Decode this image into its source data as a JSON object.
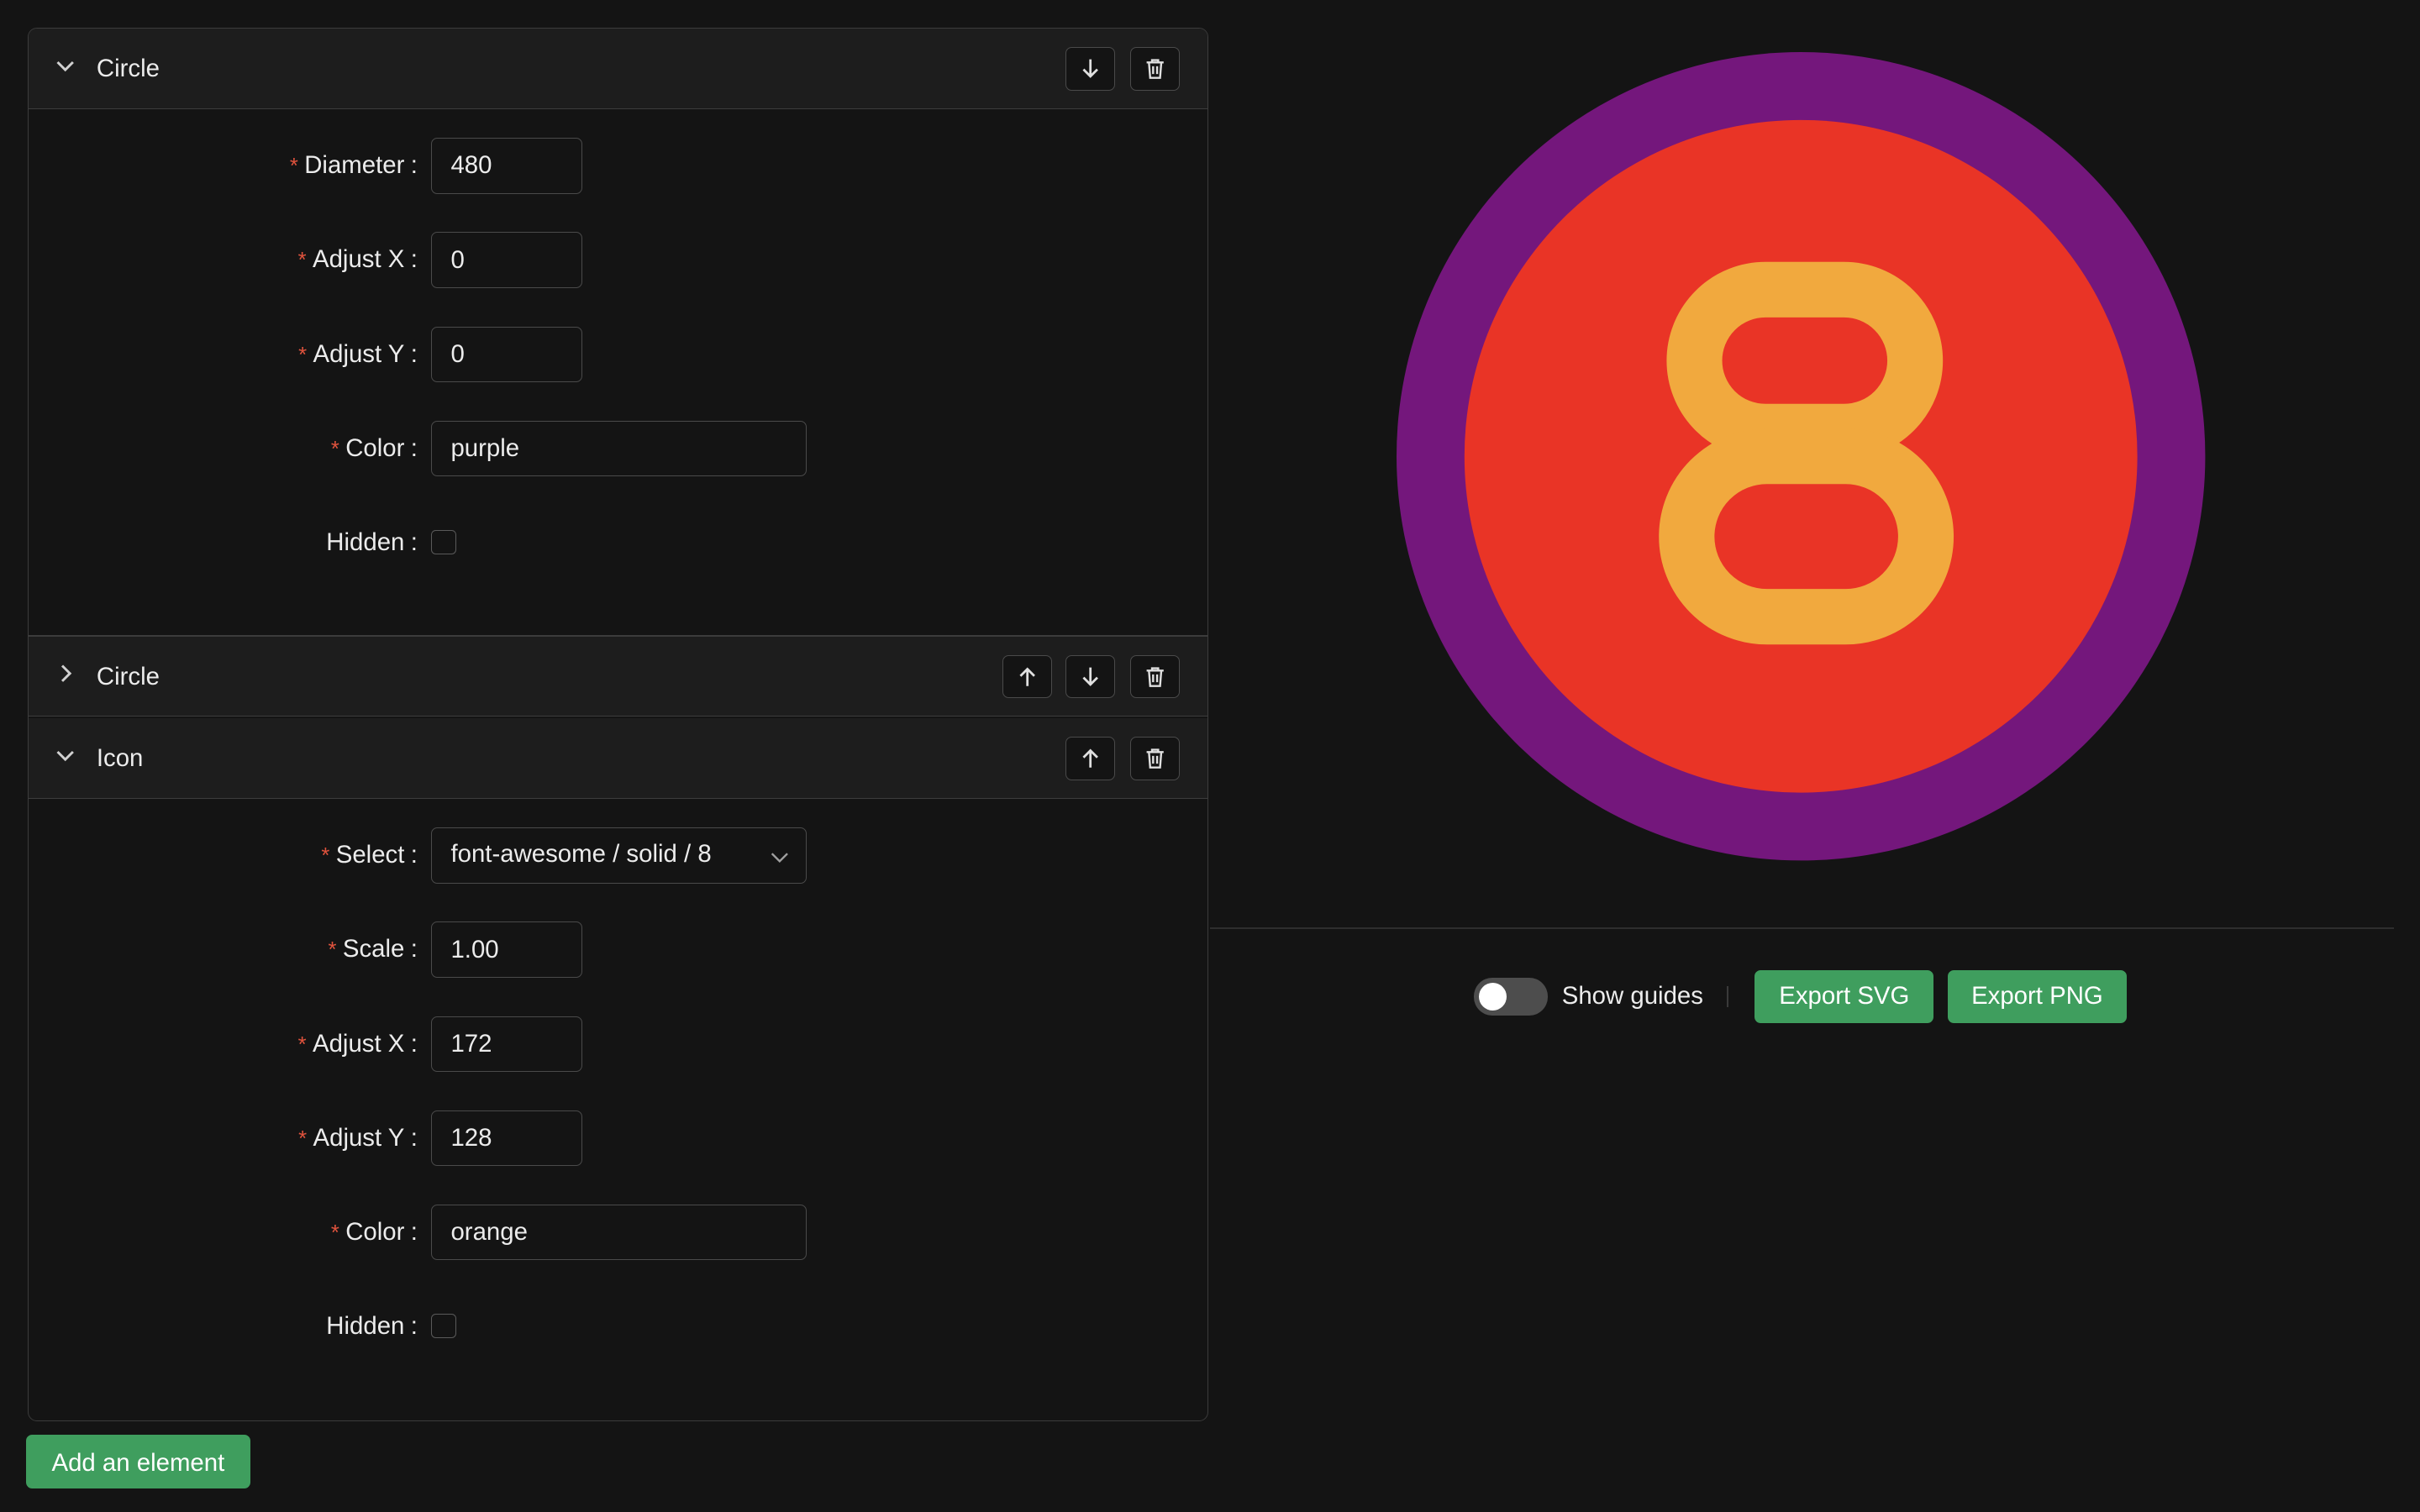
{
  "editor": {
    "sections": [
      {
        "title": "Circle",
        "fields": {
          "diameter": {
            "label": "Diameter",
            "value": "480"
          },
          "adjust_x": {
            "label": "Adjust X",
            "value": "0"
          },
          "adjust_y": {
            "label": "Adjust Y",
            "value": "0"
          },
          "color": {
            "label": "Color",
            "value": "purple"
          },
          "hidden": {
            "label": "Hidden",
            "checked": false
          }
        }
      },
      {
        "title": "Circle",
        "collapsed": true
      },
      {
        "title": "Icon",
        "fields": {
          "select": {
            "label": "Select",
            "value": "font-awesome / solid / 8"
          },
          "scale": {
            "label": "Scale",
            "value": "1.00"
          },
          "adjust_x": {
            "label": "Adjust X",
            "value": "172"
          },
          "adjust_y": {
            "label": "Adjust Y",
            "value": "128"
          },
          "color": {
            "label": "Color",
            "value": "orange"
          },
          "hidden": {
            "label": "Hidden",
            "checked": false
          }
        }
      }
    ],
    "required_mark": "*",
    "colon": ":",
    "add_element_label": "Add an element"
  },
  "preview": {
    "outer_circle_color": "#74177c",
    "inner_circle_color": "#e93426",
    "icon_color": "#f1a93e",
    "icon_name": "eight-icon"
  },
  "toolbar": {
    "show_guides_label": "Show guides",
    "show_guides_on": false,
    "export_svg_label": "Export SVG",
    "export_png_label": "Export PNG"
  },
  "colors": {
    "accent_green": "#3f9e5e",
    "required_red": "#e0533d",
    "background": "#141414"
  }
}
